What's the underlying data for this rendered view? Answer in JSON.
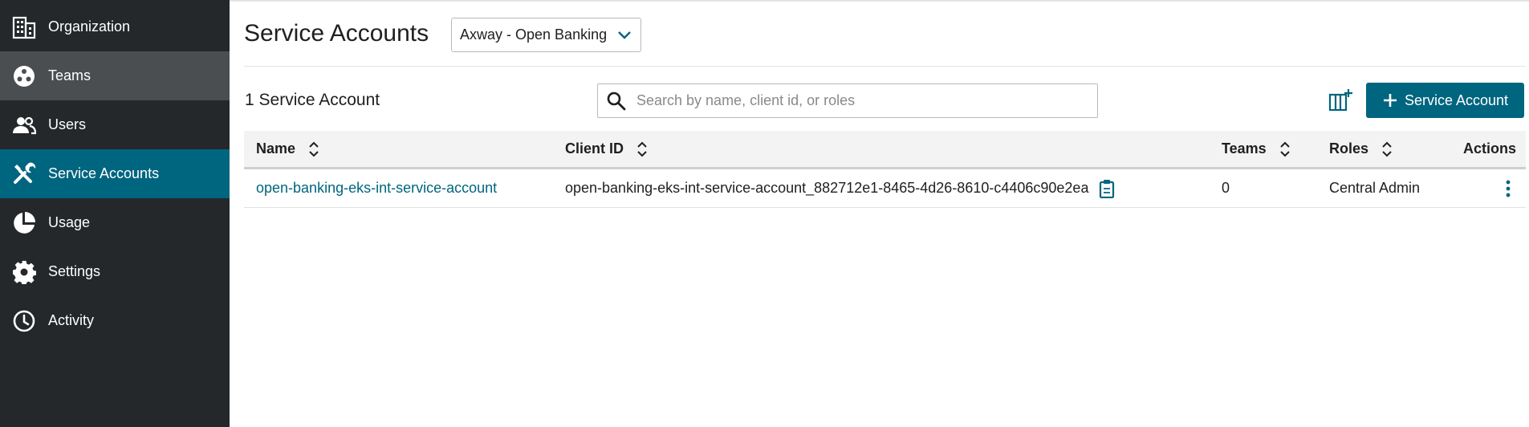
{
  "sidebar": {
    "items": [
      {
        "label": "Organization",
        "icon": "organization-icon"
      },
      {
        "label": "Teams",
        "icon": "teams-icon"
      },
      {
        "label": "Users",
        "icon": "users-icon"
      },
      {
        "label": "Service Accounts",
        "icon": "tools-icon"
      },
      {
        "label": "Usage",
        "icon": "pie-chart-icon"
      },
      {
        "label": "Settings",
        "icon": "gear-icon"
      },
      {
        "label": "Activity",
        "icon": "clock-icon"
      }
    ],
    "active": "Service Accounts",
    "hover": "Teams"
  },
  "header": {
    "title": "Service Accounts",
    "org_select": {
      "selected": "Axway - Open Banking"
    }
  },
  "toolbar": {
    "count_label": "1 Service Account",
    "search_placeholder": "Search by name, client id, or roles",
    "add_button_label": "Service Account"
  },
  "table": {
    "columns": [
      "Name",
      "Client ID",
      "Teams",
      "Roles",
      "Actions"
    ],
    "rows": [
      {
        "name": "open-banking-eks-int-service-account",
        "client_id": "open-banking-eks-int-service-account_882712e1-8465-4d26-8610-c4406c90e2ea",
        "teams": "0",
        "roles": "Central Admin"
      }
    ]
  },
  "colors": {
    "sidebar_bg": "#24282a",
    "active_bg": "#00657f",
    "hover_bg": "#4a4e50",
    "accent": "#00657f"
  }
}
